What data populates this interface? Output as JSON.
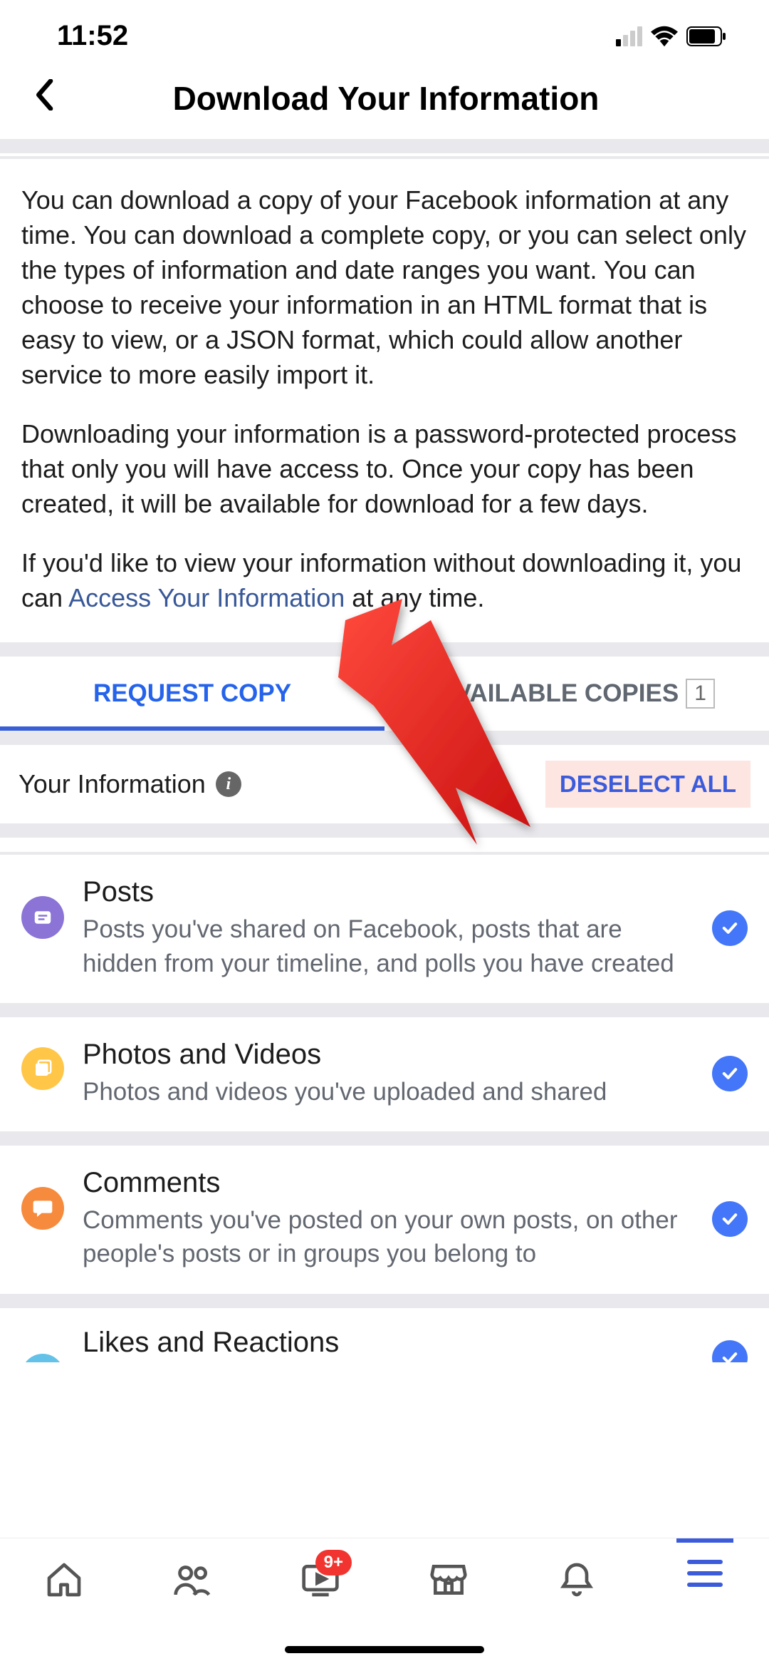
{
  "status": {
    "time": "11:52"
  },
  "header": {
    "title": "Download Your Information"
  },
  "intro": {
    "p1": "You can download a copy of your Facebook information at any time. You can download a complete copy, or you can select only the types of information and date ranges you want. You can choose to receive your information in an HTML format that is easy to view, or a JSON format, which could allow another service to more easily import it.",
    "p2": "Downloading your information is a password-protected process that only you will have access to. Once your copy has been created, it will be available for download for a few days.",
    "p3a": "If you'd like to view your information without downloading it, you can ",
    "p3link": "Access Your Information",
    "p3b": " at any time."
  },
  "tabs": {
    "request": "REQUEST COPY",
    "available": "AVAILABLE COPIES",
    "count": "1"
  },
  "section": {
    "title": "Your Information",
    "deselect": "DESELECT ALL"
  },
  "items": [
    {
      "title": "Posts",
      "desc": "Posts you've shared on Facebook, posts that are hidden from your timeline, and polls you have created"
    },
    {
      "title": "Photos and Videos",
      "desc": "Photos and videos you've uploaded and shared"
    },
    {
      "title": "Comments",
      "desc": "Comments you've posted on your own posts, on other people's posts or in groups you belong to"
    },
    {
      "title": "Likes and Reactions",
      "desc": ""
    }
  ],
  "nav_badge": "9+"
}
